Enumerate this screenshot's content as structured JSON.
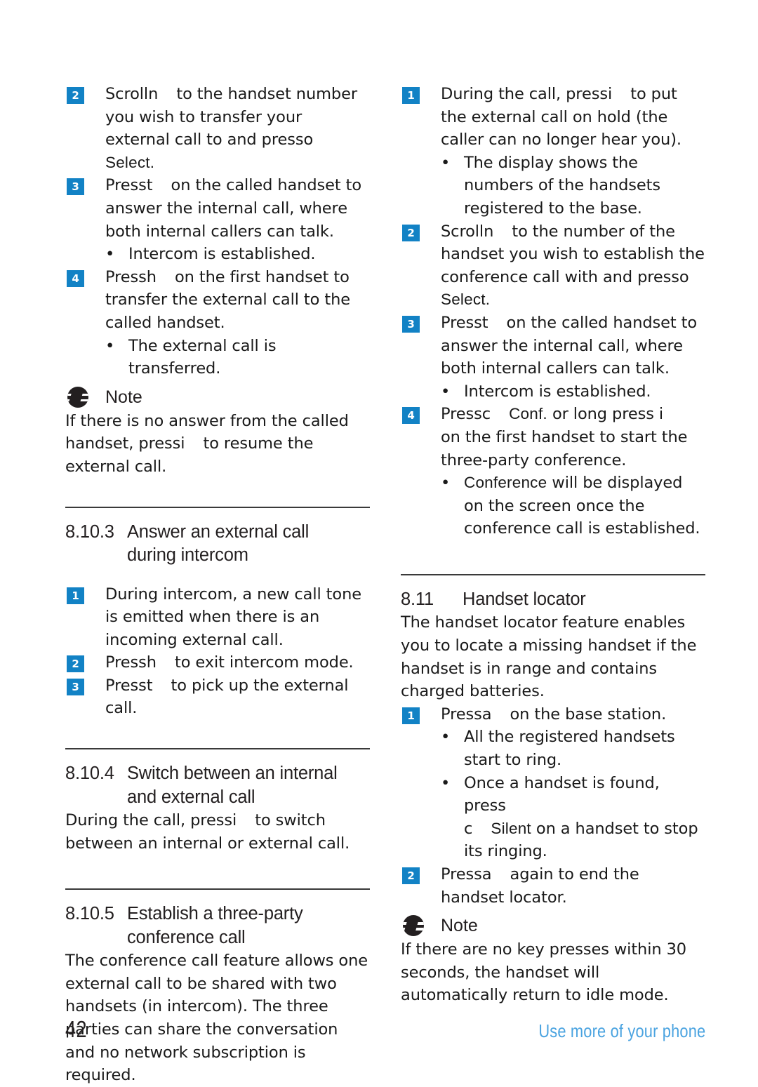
{
  "page": {
    "number": "42",
    "footer_text": "Use more of your phone",
    "accent_blue": "#1282c5",
    "footer_blue": "#4aa3e0",
    "text_color": "#1a1a1a"
  },
  "left_column": {
    "steps_transfer": [
      {
        "badge": "2",
        "text_before": "Scroll",
        "key": "n",
        "text_after": "to the handset number you wish to transfer your external call to and press",
        "key2": "o",
        "softkey": "Select",
        "text_end": "."
      },
      {
        "badge": "3",
        "text_before": "Press",
        "key": "t",
        "text_after": "on the called handset to answer the internal call, where both internal callers can talk."
      }
    ],
    "bullet_intercom": "Intercom is established.",
    "step_four": {
      "badge": "4",
      "text_before": "Press",
      "key": "h",
      "text_after": "on the first handset to transfer the external call to the called handset."
    },
    "bullet_transferred": "The external call is transferred.",
    "note_1": {
      "label": "Note",
      "text_before": "If there is no answer from the called handset, press",
      "key": "i",
      "text_after": "to resume the external call."
    },
    "section_8_10_3": {
      "number": "8.10.3",
      "title_line1": "Answer an external call",
      "title_line2": "during intercom"
    },
    "steps_answer": [
      {
        "badge": "1",
        "text": "During intercom, a new call tone is emitted when there is an incoming external call."
      },
      {
        "badge": "2",
        "text_before": "Press",
        "key": "h",
        "text_after": "to exit intercom mode."
      },
      {
        "badge": "3",
        "text_before": "Press",
        "key": "t",
        "text_after": "to pick up the external call."
      }
    ],
    "section_8_10_4": {
      "number": "8.10.4",
      "title_line1": "Switch between an internal",
      "title_line2": "and external call",
      "body_before": "During the call, press",
      "key": "i",
      "body_after": "to switch between an internal or external call."
    },
    "section_8_10_5": {
      "number": "8.10.5",
      "title_line1": "Establish a three-party",
      "title_line2": "conference call",
      "body": "The conference call feature allows one external call to be shared with two handsets (in intercom). The three parties can share the conversation and no network subscription is required."
    }
  },
  "right_column": {
    "steps_conference": [
      {
        "badge": "1",
        "text_before": "During the call, press",
        "key": "i",
        "text_after": "to put the external call on hold (the caller can no longer hear you)."
      }
    ],
    "bullet_display": "The display shows the numbers of the handsets registered to the base.",
    "step_two": {
      "badge": "2",
      "text_before": "Scroll",
      "key": "n",
      "text_after": "to the number of the handset you wish to establish the conference call with and press",
      "key2": "o",
      "softkey": "Select",
      "text_end": "."
    },
    "step_three": {
      "badge": "3",
      "text_before": "Press",
      "key": "t",
      "text_after": "on the called handset to answer the internal call, where both internal callers can talk."
    },
    "bullet_intercom": "Intercom is established.",
    "step_four": {
      "badge": "4",
      "text_before": "Press",
      "key": "c",
      "softkey": "Conf.",
      "text_middle": "or long press",
      "key2": "i",
      "text_after": "on the first handset to start the three-party conference."
    },
    "bullet_conference": {
      "softkey": "Conference",
      "text": "will be displayed on the screen once the conference call is established."
    },
    "section_8_11": {
      "number": "8.11",
      "title": "Handset locator",
      "body": "The handset locator feature enables you to locate a missing handset if the handset is in range and contains charged batteries."
    },
    "step_locator_1": {
      "badge": "1",
      "text_before": "Press",
      "key": "a",
      "text_after": "on the base station."
    },
    "bullet_ring": "All the registered handsets start to ring.",
    "bullet_silent": {
      "text_before": "Once a handset is found, press",
      "key": "c",
      "softkey": "Silent",
      "text_after": "on a handset to stop its ringing."
    },
    "step_locator_2": {
      "badge": "2",
      "text_before": "Press",
      "key": "a",
      "text_after": "again to end the handset locator."
    },
    "note_2": {
      "label": "Note",
      "text": "If there are no key presses within 30 seconds, the handset will automatically return to idle mode."
    }
  }
}
